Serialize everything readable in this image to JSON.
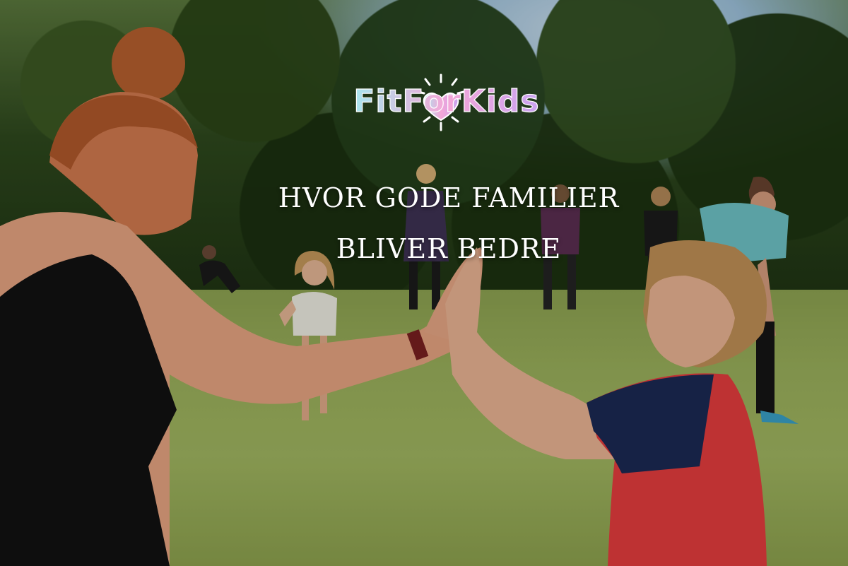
{
  "logo": {
    "text": "FitForKids",
    "colors": [
      "#a8e6ef",
      "#f4a6d7",
      "#c9a3f0"
    ]
  },
  "headline": {
    "line1": "HVOR GODE FAMILIER",
    "line2": "BLIVER BEDRE"
  }
}
